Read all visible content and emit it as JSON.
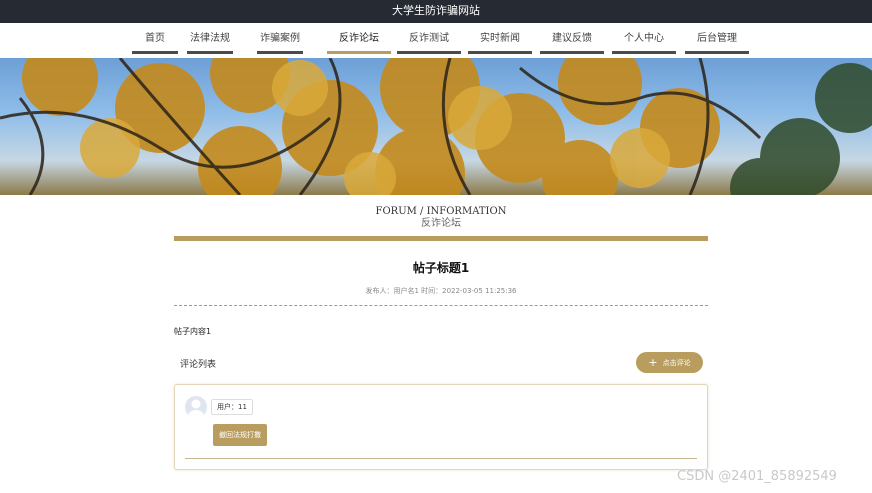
{
  "site": {
    "title": "大学生防诈骗网站"
  },
  "nav": {
    "items": [
      {
        "label": "首页"
      },
      {
        "label": "法律法规"
      },
      {
        "label": "诈骗案例"
      },
      {
        "label": "反诈论坛"
      },
      {
        "label": "反诈测试"
      },
      {
        "label": "实时新闻"
      },
      {
        "label": "建议反馈"
      },
      {
        "label": "个人中心"
      },
      {
        "label": "后台管理"
      }
    ],
    "active_index": 3
  },
  "section": {
    "en": "FORUM / INFORMATION",
    "cn": "反诈论坛"
  },
  "post": {
    "title": "帖子标题1",
    "meta": "发布人：用户名1 时间：2022-03-05 11:25:36",
    "content": "帖子内容1"
  },
  "comments": {
    "title": "评论列表",
    "add_label": "点击评论",
    "items": [
      {
        "user": "用户：11",
        "text": "撤回法规打撒"
      }
    ]
  },
  "watermark": "CSDN @2401_85892549",
  "colors": {
    "accent": "#b99d5f",
    "topbar": "#262b33",
    "nav_bar": "#4b4b4b"
  }
}
